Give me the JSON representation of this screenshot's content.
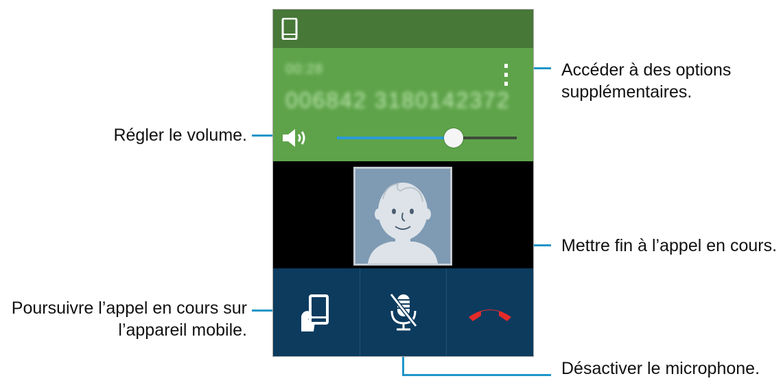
{
  "call": {
    "timer_text": "00:28",
    "number_text": "006842 3180142372",
    "volume_level": 0.65
  },
  "buttons": [
    {
      "name": "transfer-to-mobile",
      "icon": "hand-phone-icon"
    },
    {
      "name": "mute-microphone",
      "icon": "mic-off-icon"
    },
    {
      "name": "end-call",
      "icon": "end-call-icon",
      "color": "#e32b2b"
    }
  ],
  "annotations": {
    "more_options": [
      "Accéder à des options",
      "supplémentaires."
    ],
    "volume": "Régler le volume.",
    "end_call": "Mettre fin à l’appel en cours.",
    "transfer": [
      "Poursuivre l’appel en cours sur",
      "l’appareil mobile."
    ],
    "mute": "Désactiver le microphone."
  },
  "colors": {
    "status_bar": "#477838",
    "call_info": "#5ea34a",
    "buttons_bg": "#0c3b5e",
    "accent_line": "#1e95c9",
    "end_call": "#e32b2b"
  }
}
